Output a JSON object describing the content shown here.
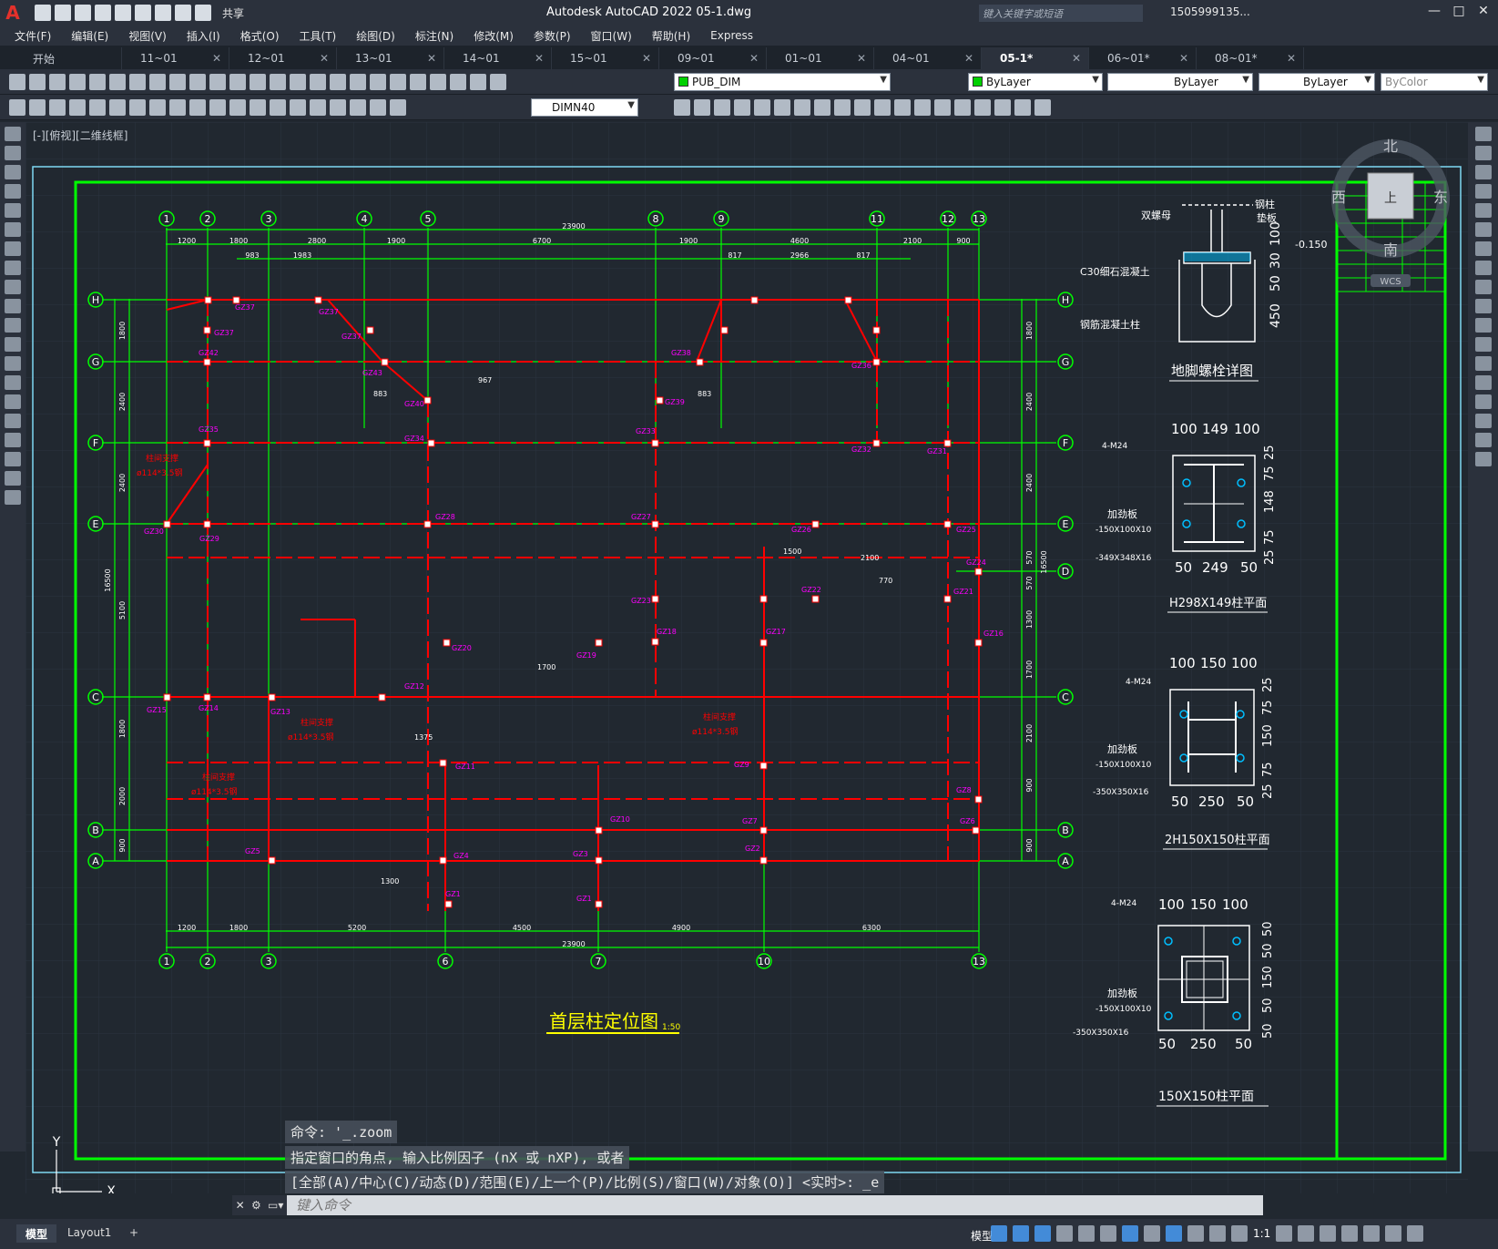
{
  "titlebar": {
    "logo": "A",
    "share": "共享",
    "title": "Autodesk AutoCAD 2022    05-1.dwg",
    "search_placeholder": "键入关键字或短语",
    "user": "1505999135...",
    "min": "—",
    "max": "□",
    "close": "✕"
  },
  "menu": [
    "文件(F)",
    "编辑(E)",
    "视图(V)",
    "插入(I)",
    "格式(O)",
    "工具(T)",
    "绘图(D)",
    "标注(N)",
    "修改(M)",
    "参数(P)",
    "窗口(W)",
    "帮助(H)",
    "Express"
  ],
  "tabs": [
    {
      "label": "开始",
      "active": false
    },
    {
      "label": "11~01",
      "active": false
    },
    {
      "label": "12~01",
      "active": false
    },
    {
      "label": "13~01",
      "active": false
    },
    {
      "label": "14~01",
      "active": false
    },
    {
      "label": "15~01",
      "active": false
    },
    {
      "label": "09~01",
      "active": false
    },
    {
      "label": "01~01",
      "active": false
    },
    {
      "label": "04~01",
      "active": false
    },
    {
      "label": "05-1*",
      "active": true
    },
    {
      "label": "06~01*",
      "active": false
    },
    {
      "label": "08~01*",
      "active": false
    }
  ],
  "toolbar": {
    "layer": "PUB_DIM",
    "color": "ByLayer",
    "linetype": "ByLayer",
    "lineweight": "ByLayer",
    "plotstyle": "ByColor",
    "dimstyle": "DIMN40"
  },
  "view_label": "[-][俯视][二维线框]",
  "viewcube": {
    "north": "北",
    "south": "南",
    "east": "东",
    "west": "西",
    "top": "上",
    "wcs": "WCS"
  },
  "drawing": {
    "main_title": "首层柱定位图",
    "scale": "1:50",
    "detail1_title": "地脚螺栓详图",
    "detail1_labels": [
      "双螺母",
      "钢柱",
      "垫板",
      "C30细石混凝土",
      "钢筋混凝土柱",
      "-0.150"
    ],
    "detail1_dims": [
      "100",
      "30",
      "50",
      "450"
    ],
    "detail2_title": "H298X149柱平面",
    "detail2_labels": [
      "4-M24",
      "加劲板",
      "-150X100X10",
      "-349X348X16"
    ],
    "detail2_top_dims": [
      "100",
      "149",
      "100"
    ],
    "detail2_bot_dims": [
      "50",
      "249",
      "50"
    ],
    "detail2_side_dims": [
      "25",
      "75",
      "148",
      "75",
      "25"
    ],
    "detail3_title": "2H150X150柱平面",
    "detail3_labels": [
      "4-M24",
      "加劲板",
      "-150X100X10",
      "-350X350X16"
    ],
    "detail3_top_dims": [
      "100",
      "150",
      "100"
    ],
    "detail3_bot_dims": [
      "50",
      "250",
      "50"
    ],
    "detail3_side_dims": [
      "25",
      "75",
      "150",
      "75",
      "25"
    ],
    "detail4_title": "150X150柱平面",
    "detail4_labels": [
      "4-M24",
      "加劲板",
      "-150X100X10",
      "-350X350X16"
    ],
    "detail4_top_dims": [
      "100",
      "150",
      "100"
    ],
    "detail4_bot_dims": [
      "50",
      "250",
      "50"
    ],
    "detail4_side_dims": [
      "50",
      "50",
      "150",
      "50",
      "50"
    ],
    "axis_top": [
      "1",
      "2",
      "3",
      "4",
      "5",
      "8",
      "9",
      "11",
      "12",
      "13"
    ],
    "axis_bottom": [
      "1",
      "2",
      "3",
      "6",
      "7",
      "10",
      "13"
    ],
    "axis_rows": [
      "H",
      "G",
      "F",
      "E",
      "D",
      "C",
      "B",
      "A"
    ],
    "top_total": "23900",
    "top_dims": [
      "1200",
      "1800",
      "2800",
      "1900",
      "6700",
      "1900",
      "4600",
      "2100",
      "900"
    ],
    "top_dims2": [
      "983",
      "1983",
      "817",
      "2966",
      "817"
    ],
    "bottom_total": "23900",
    "bottom_dims": [
      "1200",
      "1800",
      "5200",
      "4500",
      "4900",
      "6300"
    ],
    "left_dims": [
      "1800",
      "2400",
      "2400",
      "5100",
      "1800",
      "2000",
      "900"
    ],
    "left_total": "16500",
    "right_total": "16500",
    "right_dims": [
      "1800",
      "2400",
      "2400",
      "570",
      "570",
      "1300",
      "1700",
      "2100",
      "900",
      "900"
    ],
    "brace_label": "柱间支撑",
    "brace_spec": "ø114*3.5钢",
    "gz_labels": [
      "GZ37",
      "GZ37",
      "GZ37",
      "GZ37",
      "GZ42",
      "GZ43",
      "GZ40",
      "GZ39",
      "GZ38",
      "GZ36",
      "GZ35",
      "GZ34",
      "GZ33",
      "GZ32",
      "GZ31",
      "GZ30",
      "GZ29",
      "GZ28",
      "GZ27",
      "GZ26",
      "GZ25",
      "GZ24",
      "GZ23",
      "GZ22",
      "GZ21",
      "GZ20",
      "GZ19",
      "GZ18",
      "GZ17",
      "GZ16",
      "GZ15",
      "GZ14",
      "GZ13",
      "GZ12",
      "GZ11",
      "GZ10",
      "GZ9",
      "GZ8",
      "GZ7",
      "GZ6",
      "GZ5",
      "GZ4",
      "GZ3",
      "GZ2",
      "GZ1",
      "GZ1"
    ],
    "misc_dims": [
      "883",
      "967",
      "1500",
      "1375",
      "1700",
      "1300",
      "2100",
      "770"
    ]
  },
  "command": {
    "line1": "命令: '_.zoom",
    "line2": "指定窗口的角点, 输入比例因子 (nX 或 nXP), 或者",
    "line3": "[全部(A)/中心(C)/动态(D)/范围(E)/上一个(P)/比例(S)/窗口(W)/对象(O)] <实时>: _e",
    "placeholder": "键入命令"
  },
  "status": {
    "model_tab": "模型",
    "layout_tab": "Layout1",
    "add_tab": "+",
    "model_label": "模型",
    "scale": "1:1"
  },
  "colors": {
    "background": "#212830",
    "frame": "#00ff00",
    "axis": "#00ff00",
    "beam": "#ff0000",
    "column_label": "#ff00ff",
    "text": "#ffffff",
    "title_yellow": "#ffff00"
  }
}
